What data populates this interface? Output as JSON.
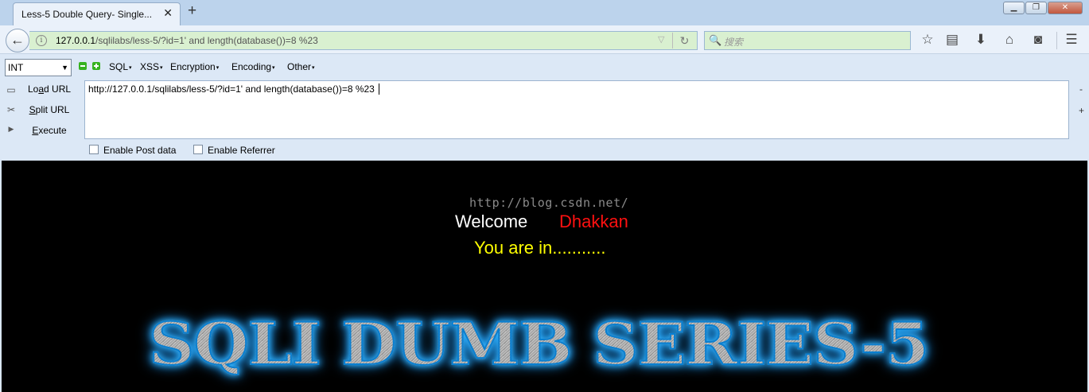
{
  "browser": {
    "tab_title": "Less-5 Double Query- Single...",
    "tab_close": "✕",
    "new_tab": "+",
    "window_buttons": {
      "minimize": "▁",
      "restore": "❐",
      "close": "✕"
    }
  },
  "navbar": {
    "back_icon": "←",
    "info_icon": "i",
    "url_host": "127.0.0.1",
    "url_path": "/sqlilabs/less-5/?id=1'  and length(database())=8 %23",
    "dropdown_icon": "▽",
    "reload_icon": "↻",
    "search_icon": "🔍",
    "search_placeholder": "搜索",
    "icons": {
      "bookmark": "☆",
      "reading_list": "▤",
      "download": "⬇",
      "home": "⌂",
      "pocket": "◙",
      "menu": "☰"
    }
  },
  "hackbar": {
    "select_value": "INT",
    "select_arrow": "▼",
    "menus": [
      {
        "label": "SQL"
      },
      {
        "label": "XSS"
      },
      {
        "label": "Encryption"
      },
      {
        "label": "Encoding"
      },
      {
        "label": "Other"
      }
    ],
    "menu_caret": "▾",
    "buttons": {
      "load_url_pre": "Lo",
      "load_url_ul": "a",
      "load_url_post": "d URL",
      "split_url_pre": "",
      "split_url_ul": "S",
      "split_url_post": "plit URL",
      "execute_pre": "",
      "execute_ul": "E",
      "execute_post": "xecute"
    },
    "side_icons": {
      "load": "▭",
      "split": "✂",
      "execute": "▶"
    },
    "url_value": "http://127.0.0.1/sqlilabs/less-5/?id=1'  and length(database())=8 %23",
    "right_minus": "-",
    "right_plus": "+",
    "enable_post_data": "Enable Post data",
    "enable_referrer": "Enable Referrer"
  },
  "page": {
    "watermark": "http://blog.csdn.net/",
    "welcome": "Welcome",
    "name": "Dhakkan",
    "status": "You are in...........",
    "banner": "SQLI DUMB SERIES-5"
  },
  "colors": {
    "page_background": "#000000",
    "welcome": "#ffffff",
    "name": "#ff1010",
    "status": "#ffff00",
    "banner_glow": "#2fb4ff",
    "url_bar_background": "#d9f0d0"
  }
}
